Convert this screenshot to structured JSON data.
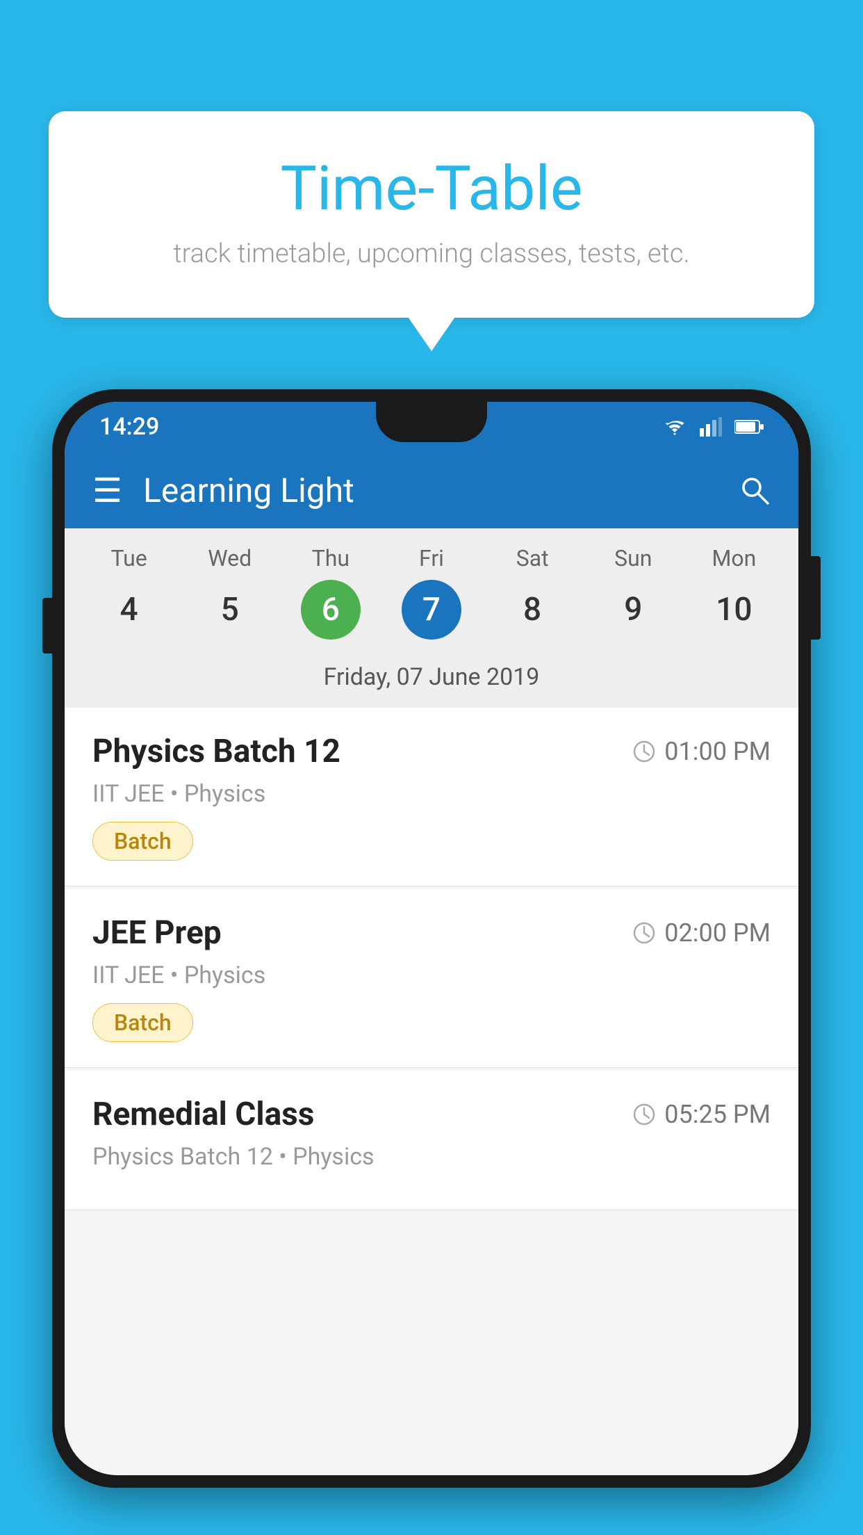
{
  "background_color": "#29b6e8",
  "speech_bubble": {
    "title": "Time-Table",
    "subtitle": "track timetable, upcoming classes, tests, etc."
  },
  "phone": {
    "status_bar": {
      "time": "14:29"
    },
    "app_bar": {
      "title": "Learning Light"
    },
    "calendar": {
      "days": [
        {
          "label": "Tue",
          "number": "4",
          "state": "normal"
        },
        {
          "label": "Wed",
          "number": "5",
          "state": "normal"
        },
        {
          "label": "Thu",
          "number": "6",
          "state": "today"
        },
        {
          "label": "Fri",
          "number": "7",
          "state": "selected"
        },
        {
          "label": "Sat",
          "number": "8",
          "state": "normal"
        },
        {
          "label": "Sun",
          "number": "9",
          "state": "normal"
        },
        {
          "label": "Mon",
          "number": "10",
          "state": "normal"
        }
      ],
      "selected_date_label": "Friday, 07 June 2019"
    },
    "schedule": [
      {
        "name": "Physics Batch 12",
        "time": "01:00 PM",
        "meta": "IIT JEE • Physics",
        "badge": "Batch"
      },
      {
        "name": "JEE Prep",
        "time": "02:00 PM",
        "meta": "IIT JEE • Physics",
        "badge": "Batch"
      },
      {
        "name": "Remedial Class",
        "time": "05:25 PM",
        "meta": "Physics Batch 12 • Physics",
        "badge": null
      }
    ]
  }
}
